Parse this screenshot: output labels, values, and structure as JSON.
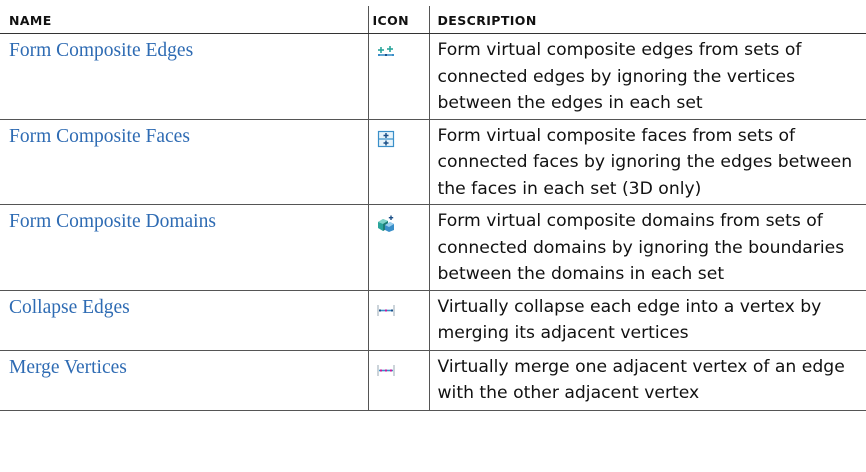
{
  "table": {
    "headers": {
      "name": "NAME",
      "icon": "ICON",
      "description": "DESCRIPTION"
    },
    "rows": [
      {
        "name": "Form Composite Edges",
        "icon": "form-composite-edges-icon",
        "description": "Form virtual composite edges from sets of connected edges by ignoring the vertices between the edges in each set"
      },
      {
        "name": "Form Composite Faces",
        "icon": "form-composite-faces-icon",
        "description": "Form virtual composite faces from sets of connected faces by ignoring the edges between the faces in each set (3D only)"
      },
      {
        "name": "Form Composite Domains",
        "icon": "form-composite-domains-icon",
        "description": "Form virtual composite domains from sets of connected domains by ignoring the boundaries between the domains in each set"
      },
      {
        "name": "Collapse Edges",
        "icon": "collapse-edges-icon",
        "description": "Virtually collapse each edge into a vertex by merging its adjacent vertices"
      },
      {
        "name": "Merge Vertices",
        "icon": "merge-vertices-icon",
        "description": "Virtually merge one adjacent vertex of an edge with the other adjacent vertex"
      }
    ]
  },
  "colors": {
    "link": "#2e6bb3",
    "icon_blue": "#3a8fc9",
    "icon_teal": "#2aa59b",
    "vertex_magenta": "#c2189c"
  }
}
